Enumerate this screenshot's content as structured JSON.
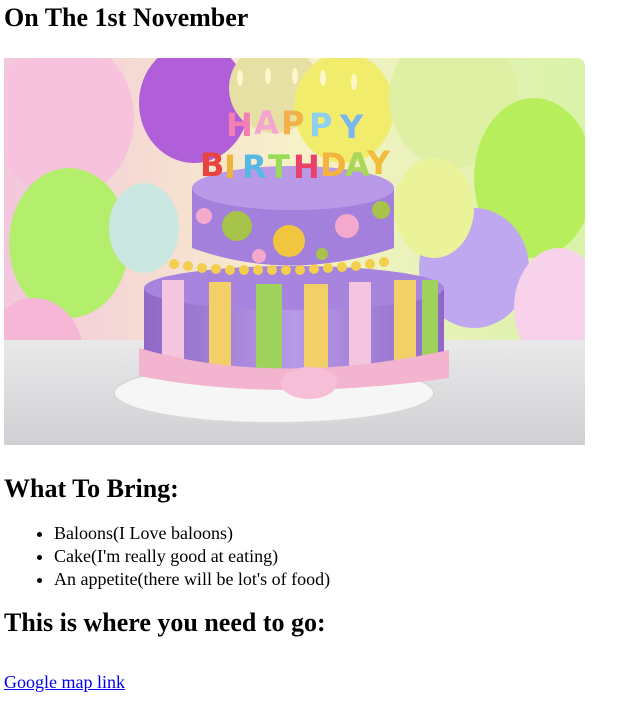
{
  "header": {
    "title": "On The 1st November"
  },
  "image": {
    "alt": "Birthday cake",
    "candle_letters": [
      "H",
      "A",
      "P",
      "P",
      "Y",
      "B",
      "I",
      "R",
      "T",
      "H",
      "D",
      "A",
      "Y"
    ]
  },
  "bring": {
    "heading": "What To Bring:",
    "items": [
      "Baloons(I Love baloons)",
      "Cake(I'm really good at eating)",
      "An appetite(there will be lot's of food)"
    ]
  },
  "directions": {
    "heading": "This is where you need to go:",
    "link_label": "Google map link"
  },
  "colors": {
    "link": "#0000ee",
    "text": "#000000"
  }
}
